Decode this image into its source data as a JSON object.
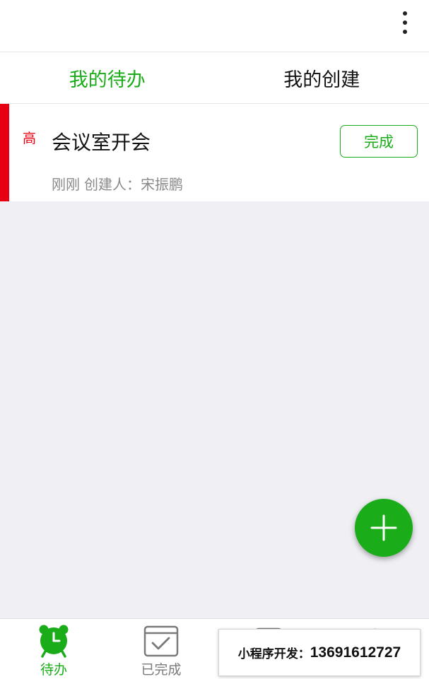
{
  "tabs": [
    {
      "label": "我的待办",
      "active": true
    },
    {
      "label": "我的创建",
      "active": false
    }
  ],
  "task": {
    "priority": "高",
    "title": "会议室开会",
    "time": "刚刚",
    "creator_label": "创建人：",
    "creator": "宋振鹏",
    "done_button": "完成"
  },
  "fab": {
    "icon": "plus-icon"
  },
  "tabbar": [
    {
      "label": "待办",
      "icon": "alarm-clock-icon",
      "active": true
    },
    {
      "label": "已完成",
      "icon": "checkbox-icon",
      "active": false
    },
    {
      "label": "",
      "icon": "partially-hidden-icon",
      "active": false
    },
    {
      "label": "",
      "icon": "partially-hidden-icon",
      "active": false
    }
  ],
  "overlay": {
    "label": "小程序开发：",
    "phone": "13691612727"
  },
  "colors": {
    "accent": "#1aad19",
    "priority_high": "#e60012",
    "background": "#efeff4"
  }
}
